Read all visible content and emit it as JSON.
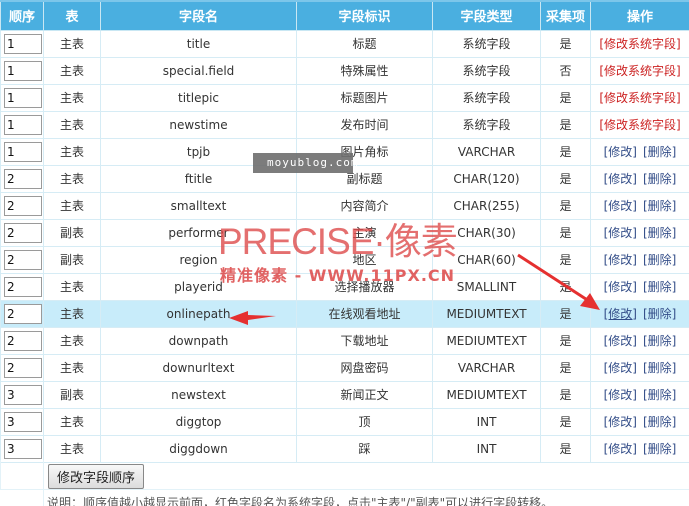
{
  "table": {
    "headers": [
      "顺序",
      "表",
      "字段名",
      "字段标识",
      "字段类型",
      "采集项",
      "操作"
    ],
    "rows": [
      {
        "order": "1",
        "table": "主表",
        "field": "title",
        "label": "标题",
        "type": "系统字段",
        "collect": "是",
        "system": true,
        "op_edit_sys": "[修改系统字段]"
      },
      {
        "order": "1",
        "table": "主表",
        "field": "special.field",
        "label": "特殊属性",
        "type": "系统字段",
        "collect": "否",
        "system": true,
        "op_edit_sys": "[修改系统字段]"
      },
      {
        "order": "1",
        "table": "主表",
        "field": "titlepic",
        "label": "标题图片",
        "type": "系统字段",
        "collect": "是",
        "system": true,
        "op_edit_sys": "[修改系统字段]"
      },
      {
        "order": "1",
        "table": "主表",
        "field": "newstime",
        "label": "发布时间",
        "type": "系统字段",
        "collect": "是",
        "system": true,
        "op_edit_sys": "[修改系统字段]"
      },
      {
        "order": "1",
        "table": "主表",
        "field": "tpjb",
        "label": "图片角标",
        "type": "VARCHAR",
        "collect": "是",
        "system": false,
        "op_edit": "[修改]",
        "op_delete": "[删除]"
      },
      {
        "order": "2",
        "table": "主表",
        "field": "ftitle",
        "label": "副标题",
        "type": "CHAR(120)",
        "collect": "是",
        "system": false,
        "op_edit": "[修改]",
        "op_delete": "[删除]"
      },
      {
        "order": "2",
        "table": "主表",
        "field": "smalltext",
        "label": "内容简介",
        "type": "CHAR(255)",
        "collect": "是",
        "system": false,
        "op_edit": "[修改]",
        "op_delete": "[删除]"
      },
      {
        "order": "2",
        "table": "副表",
        "field": "performer",
        "label": "主演",
        "type": "CHAR(30)",
        "collect": "是",
        "system": false,
        "op_edit": "[修改]",
        "op_delete": "[删除]"
      },
      {
        "order": "2",
        "table": "副表",
        "field": "region",
        "label": "地区",
        "type": "CHAR(60)",
        "collect": "是",
        "system": false,
        "op_edit": "[修改]",
        "op_delete": "[删除]"
      },
      {
        "order": "2",
        "table": "主表",
        "field": "playerid",
        "label": "选择播放器",
        "type": "SMALLINT",
        "collect": "是",
        "system": false,
        "op_edit": "[修改]",
        "op_delete": "[删除]"
      },
      {
        "order": "2",
        "table": "主表",
        "field": "onlinepath",
        "label": "在线观看地址",
        "type": "MEDIUMTEXT",
        "collect": "是",
        "system": false,
        "highlighted": true,
        "op_edit": "[修改]",
        "op_delete": "[删除]"
      },
      {
        "order": "2",
        "table": "主表",
        "field": "downpath",
        "label": "下载地址",
        "type": "MEDIUMTEXT",
        "collect": "是",
        "system": false,
        "op_edit": "[修改]",
        "op_delete": "[删除]"
      },
      {
        "order": "2",
        "table": "主表",
        "field": "downurltext",
        "label": "网盘密码",
        "type": "VARCHAR",
        "collect": "是",
        "system": false,
        "op_edit": "[修改]",
        "op_delete": "[删除]"
      },
      {
        "order": "3",
        "table": "副表",
        "field": "newstext",
        "label": "新闻正文",
        "type": "MEDIUMTEXT",
        "collect": "是",
        "system": false,
        "op_edit": "[修改]",
        "op_delete": "[删除]"
      },
      {
        "order": "3",
        "table": "主表",
        "field": "diggtop",
        "label": "顶",
        "type": "INT",
        "collect": "是",
        "system": false,
        "op_edit": "[修改]",
        "op_delete": "[删除]"
      },
      {
        "order": "3",
        "table": "主表",
        "field": "diggdown",
        "label": "踩",
        "type": "INT",
        "collect": "是",
        "system": false,
        "op_edit": "[修改]",
        "op_delete": "[删除]"
      }
    ]
  },
  "footer": {
    "save_order_button": "修改字段顺序",
    "note": "说明：顺序值越小越显示前面，红色字段名为系统字段，点击\"主表\"/\"副表\"可以进行字段转移。"
  },
  "watermarks": {
    "blog": "moyublog.com",
    "brand": "PRECISE·像素",
    "url": "精准像素 - WWW.11PX.CN"
  },
  "colors": {
    "header_bg": "#4aafe0",
    "system_field": "#cc2222",
    "highlight_row": "#c8ecfa",
    "annotation_arrow": "#e53030"
  }
}
